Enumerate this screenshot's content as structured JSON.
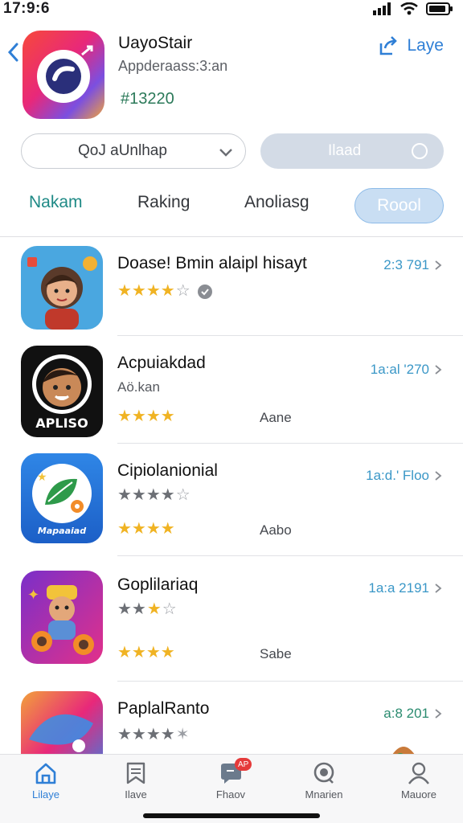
{
  "status_bar": {
    "time": "17:9:6"
  },
  "header": {
    "app_name": "UayoStair",
    "app_subtitle": "Appderaass:3:an",
    "app_count": "#13220",
    "share_label": "Laye"
  },
  "filters": {
    "select_value": "QoJ aUnlhap",
    "toggle_label": "Ilaad"
  },
  "tabs": [
    {
      "label": "Nakam"
    },
    {
      "label": "Raking"
    },
    {
      "label": "Anoliasg"
    },
    {
      "label": "Roool"
    }
  ],
  "list": [
    {
      "title": "Doase! Bmin alaipl hisayt",
      "subtitle": "",
      "meta": "2:3 791",
      "extra": "",
      "rating_stars": 4
    },
    {
      "title": "Acpuiakdad",
      "subtitle": "Aö.kan",
      "meta": "1a:al '270",
      "extra": "Aane",
      "rating_stars": 4,
      "icon_text": "APLISO"
    },
    {
      "title": "Cipiolanionial",
      "subtitle": "",
      "meta": "1a:d.' Floo",
      "extra": "Aabo",
      "rating_stars": 4,
      "icon_text": "Mapaaiad"
    },
    {
      "title": "Goplilariaq",
      "subtitle": "",
      "meta": "1a:a 2191",
      "extra": "Sabe",
      "rating_stars": 4
    },
    {
      "title": "PaplalRanto",
      "subtitle": "",
      "meta": "a:8 201",
      "extra": "",
      "rating_stars": 3
    }
  ],
  "tabbar": [
    {
      "label": "Lilaye",
      "icon": "home-icon"
    },
    {
      "label": "Ilave",
      "icon": "bookmark-icon"
    },
    {
      "label": "Fhaov",
      "icon": "chat-icon",
      "badge": "AP"
    },
    {
      "label": "Mnarien",
      "icon": "search-icon"
    },
    {
      "label": "Mauore",
      "icon": "profile-icon"
    }
  ],
  "colors": {
    "accent": "#2f7fd6",
    "active_tab": "#1f8a86",
    "star": "#f0b323"
  }
}
